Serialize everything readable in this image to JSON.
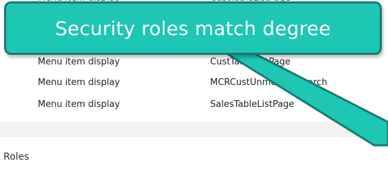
{
  "grid": {
    "rows": [
      {
        "type": "Menu item display",
        "name": "CustTableListPage"
      },
      {
        "type": "Menu item display",
        "name": "CustTableListPage"
      },
      {
        "type": "Menu item display",
        "name": "MCRCustUnmergedSearch"
      },
      {
        "type": "Menu item display",
        "name": "SalesTableListPage"
      }
    ]
  },
  "section": {
    "label": "Roles"
  },
  "callout": {
    "text": "Security roles match degree",
    "fill_color": "#1ec6b4",
    "border_color": "#167a70"
  }
}
